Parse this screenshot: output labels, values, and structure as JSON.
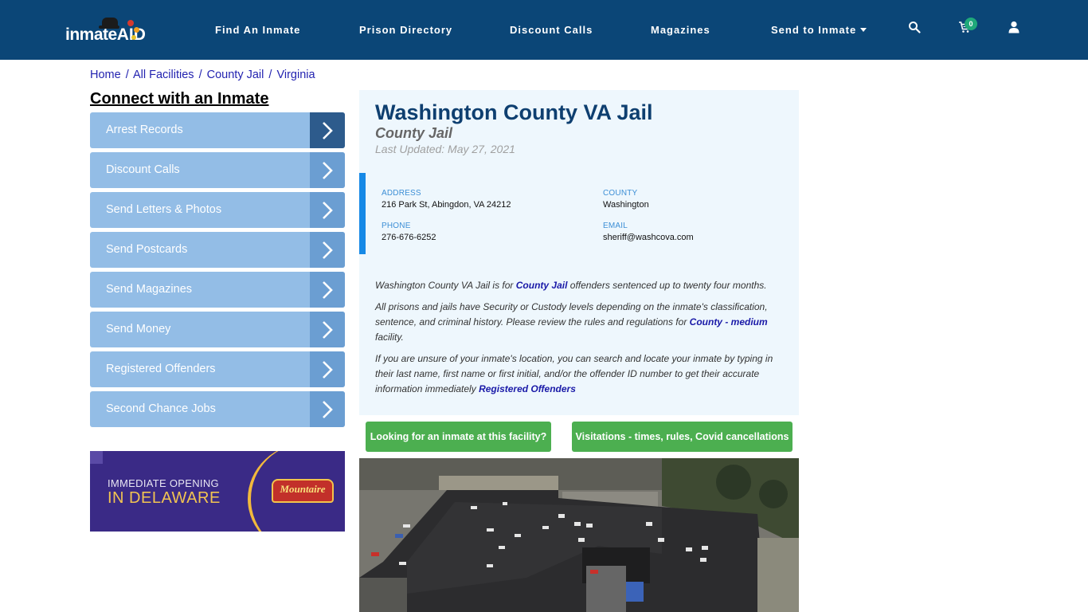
{
  "header": {
    "logo_text": "inmate",
    "logo_accent": "AID",
    "nav": [
      {
        "label": "Find An Inmate"
      },
      {
        "label": "Prison Directory"
      },
      {
        "label": "Discount Calls"
      },
      {
        "label": "Magazines"
      },
      {
        "label": "Send to Inmate"
      }
    ],
    "cart_count": "0",
    "icons": [
      "search-icon",
      "cart-icon",
      "user-icon"
    ]
  },
  "breadcrumb": [
    {
      "label": "Home"
    },
    {
      "label": "All Facilities"
    },
    {
      "label": "County Jail"
    },
    {
      "label": "Virginia"
    }
  ],
  "breadcrumb_separator": "/",
  "sidebar": {
    "title": "Connect with an Inmate",
    "items": [
      {
        "label": "Arrest Records",
        "active": true
      },
      {
        "label": "Discount Calls"
      },
      {
        "label": "Send Letters & Photos"
      },
      {
        "label": "Send Postcards"
      },
      {
        "label": "Send Magazines"
      },
      {
        "label": "Send Money"
      },
      {
        "label": "Registered Offenders"
      },
      {
        "label": "Second Chance Jobs"
      }
    ],
    "ad": {
      "line1": "IMMEDIATE OPENING",
      "line2": "IN DELAWARE",
      "brand": "Mountaire"
    }
  },
  "facility": {
    "name": "Washington County VA Jail",
    "type": "County Jail",
    "last_updated": "Last Updated: May 27, 2021",
    "address_label": "ADDRESS",
    "address": "216 Park St, Abingdon, VA 24212",
    "county_label": "COUNTY",
    "county": "Washington",
    "phone_label": "PHONE",
    "phone": "276-676-6252",
    "email_label": "EMAIL",
    "email": "sheriff@washcova.com"
  },
  "description": {
    "p1_before": "Washington County VA Jail is for ",
    "p1_link": "County Jail",
    "p1_after": " offenders sentenced up to twenty four months.",
    "p2_before": "All prisons and jails have Security or Custody levels depending on the inmate's classification, sentence, and criminal history. Please review the rules and regulations for ",
    "p2_link": "County - medium",
    "p2_after": " facility.",
    "p3_before": "If you are unsure of your inmate's location, you can search and locate your inmate by typing in their last name, first name or first initial, and/or the offender ID number to get their accurate information immediately ",
    "p3_link": "Registered Offenders"
  },
  "buttons": {
    "looking": "Looking for an inmate at this facility?",
    "visitations": "Visitations - times, rules, Covid cancellations"
  },
  "colors": {
    "header_bg": "#0b4677",
    "sidebar_item": "#93bde6",
    "sidebar_arrow": "#6b9ed2",
    "sidebar_arrow_active": "#2d5b8c",
    "card_bg": "#eef7fd",
    "accent_bar": "#1689e6",
    "title": "#0e3f70",
    "green_button": "#4caf50",
    "link": "#1a1aa8"
  }
}
